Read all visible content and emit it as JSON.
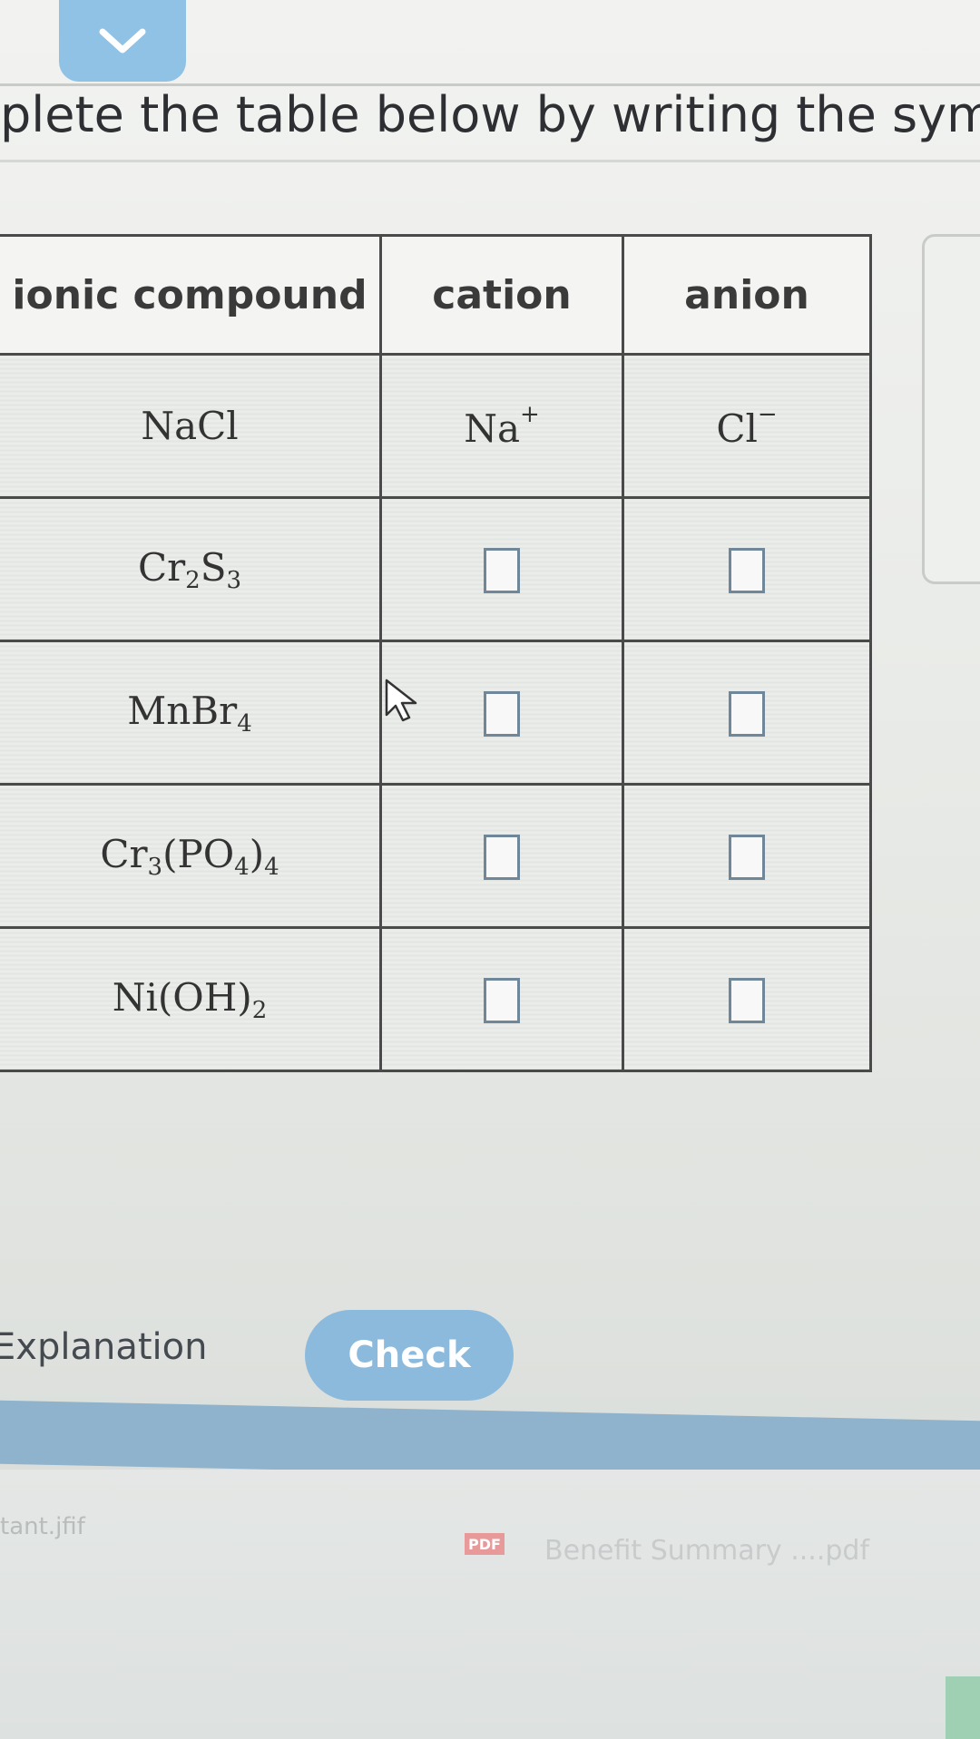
{
  "header": {
    "instruction": "plete the table below by writing the symbo"
  },
  "table": {
    "columns": [
      "ionic compound",
      "cation",
      "anion"
    ],
    "rows": [
      {
        "compound": [
          {
            "t": "NaCl"
          }
        ],
        "cation": [
          {
            "t": "Na"
          },
          {
            "sup": "+"
          }
        ],
        "anion": [
          {
            "t": "Cl"
          },
          {
            "sup": "−"
          }
        ]
      },
      {
        "compound": [
          {
            "t": "Cr"
          },
          {
            "sub": "2"
          },
          {
            "t": "S"
          },
          {
            "sub": "3"
          }
        ],
        "cation": "box",
        "anion": "box"
      },
      {
        "compound": [
          {
            "t": "MnBr"
          },
          {
            "sub": "4"
          }
        ],
        "cation": "box",
        "anion": "box"
      },
      {
        "compound": [
          {
            "t": "Cr"
          },
          {
            "sub": "3"
          },
          {
            "t": "(PO"
          },
          {
            "sub": "4"
          },
          {
            "t": ")"
          },
          {
            "sub": "4"
          }
        ],
        "cation": "box",
        "anion": "box"
      },
      {
        "compound": [
          {
            "t": "Ni(OH)"
          },
          {
            "sub": "2"
          }
        ],
        "cation": "box",
        "anion": "box"
      }
    ]
  },
  "actions": {
    "explanation_label": "Explanation",
    "check_label": "Check"
  },
  "downloads": {
    "file1": "tant.jfif",
    "file2_badge": "PDF",
    "file2": "Benefit Summary ....pdf"
  },
  "colors": {
    "accent": "#8cbadd",
    "chevron_button": "#8fc2e4"
  }
}
